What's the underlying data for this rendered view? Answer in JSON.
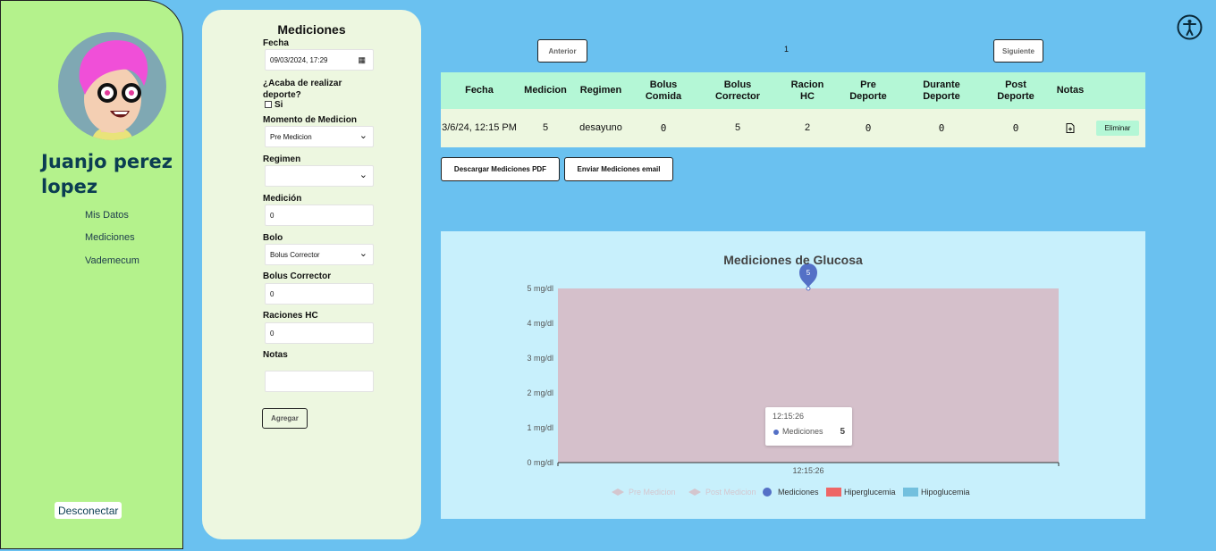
{
  "sidebar": {
    "user_name": "Juanjo perez lopez",
    "nav": [
      "Mis Datos",
      "Mediciones",
      "Vademecum"
    ],
    "logout_label": "Desconectar"
  },
  "form": {
    "title": "Mediciones",
    "fecha_label": "Fecha",
    "fecha_value": "09/03/2024, 17:29",
    "deporte_label": "¿Acaba de realizar deporte?",
    "si_label": "Si",
    "momento_label": "Momento de Medicion",
    "momento_value": "Pre Medicion",
    "regimen_label": "Regimen",
    "regimen_value": "",
    "medicion_label": "Medición",
    "medicion_value": "0",
    "bolo_label": "Bolo",
    "bolo_value": "Bolus Corrector",
    "bolus_corrector_label": "Bolus Corrector",
    "bolus_corrector_value": "0",
    "raciones_label": "Raciones HC",
    "raciones_value": "0",
    "notas_label": "Notas",
    "notas_value": "",
    "submit_label": "Agregar"
  },
  "pager": {
    "prev_label": "Anterior",
    "page": "1",
    "next_label": "Siguiente"
  },
  "table": {
    "headers": [
      "Fecha",
      "Medicion",
      "Regimen",
      "Bolus Comida",
      "Bolus Corrector",
      "Racion HC",
      "Pre Deporte",
      "Durante Deporte",
      "Post Deporte",
      "Notas"
    ],
    "rows": [
      {
        "fecha": "3/6/24, 12:15 PM",
        "medicion": "5",
        "regimen": "desayuno",
        "bolus_comida": "0",
        "bolus_corrector": "5",
        "racion_hc": "2",
        "pre_deporte": "0",
        "durante_deporte": "0",
        "post_deporte": "0",
        "notas_icon": "note-add-icon",
        "delete_label": "Eliminar"
      }
    ]
  },
  "actions": {
    "pdf_label": "Descargar Mediciones PDF",
    "email_label": "Enviar Mediciones email"
  },
  "chart_data": {
    "type": "line",
    "title": "Mediciones de Glucosa",
    "x": [
      "12:15:26"
    ],
    "y_ticks": [
      "0 mg/dl",
      "1 mg/dl",
      "2 mg/dl",
      "3 mg/dl",
      "4 mg/dl",
      "5 mg/dl"
    ],
    "ylim": [
      0,
      5
    ],
    "series": [
      {
        "name": "Pre Medicion",
        "values": [],
        "color": "#e2b3bf",
        "hidden": true
      },
      {
        "name": "Post Medicion",
        "values": [],
        "color": "#e2b3bf",
        "hidden": true
      },
      {
        "name": "Mediciones",
        "values": [
          5
        ],
        "color": "#5470c6"
      },
      {
        "name": "Hiperglucemia",
        "values": [],
        "color": "#ee6666"
      },
      {
        "name": "Hipoglucemia",
        "values": [],
        "color": "#73c0de"
      }
    ],
    "hyper_band_range": [
      0,
      5
    ],
    "band_color": "#d5c0cb",
    "marker_label": "5",
    "tooltip": {
      "time": "12:15:26",
      "series": "Mediciones",
      "value": "5"
    }
  }
}
